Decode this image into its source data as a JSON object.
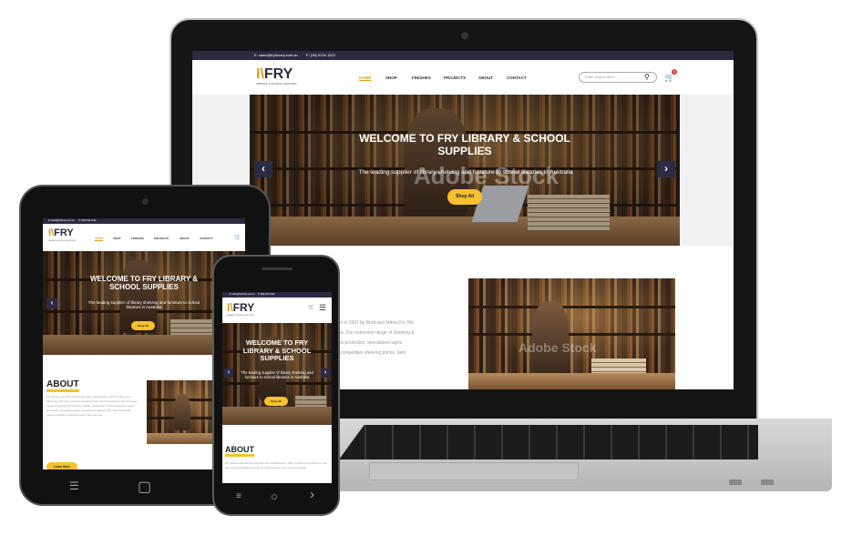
{
  "site": {
    "topbar": {
      "email": "E: sales@fryflorary.com.au",
      "phone": "P: (08) 9194 1522"
    },
    "logo": {
      "mark": "I\\",
      "name": "FRY",
      "sub": "LIBRARY & SCHOOL SUPPLIES"
    },
    "nav": [
      "HOME",
      "SHOP",
      "FINISHES",
      "PROJECTS",
      "ABOUT",
      "CONTACT"
    ],
    "search": {
      "placeholder": "Enter search here..."
    },
    "cart": {
      "count": "0"
    },
    "hero": {
      "title": "WELCOME TO FRY LIBRARY & SCHOOL SUPPLIES",
      "subtitle": "The leading supplier of library shelving and furniture to school libraries in Australia",
      "button": "Shop All",
      "watermark": "Adobe Stock",
      "prev": "‹",
      "next": "›"
    },
    "about": {
      "heading": "ABOUT",
      "text_laptop": [
        "ted in 1997 by Brett and Mitna Fry. We",
        "ess. Our extensive range of shelving &",
        "ook protection, specialised tapes",
        "e competitive shelving prices, best"
      ],
      "text_tablet": "Fry Library and School Supplies was established in 1997 by Brett and Mitna Fry. We are a proud Australian family-owned business. Our extensive range of shelving & furniture, display, equipment, office equipment, book protection, specialised tapes & cleaning supplies. We make Australia's most competitive shelving prices, best service.",
      "text_phone": "Fry Library and School Supplies was established in 1997 by Brett and Mitna Fry. We are a proud Australian family owned business. Our extensive range",
      "button": "Learn More"
    }
  },
  "tablet": {
    "home_glyph": "▢",
    "menu_glyph": "☰"
  },
  "phone": {
    "menu_glyph": "≡",
    "home_glyph": "○",
    "back_glyph": "›"
  },
  "colors": {
    "navy": "#2d2a42",
    "accent": "#f5c12e",
    "orange": "#e49b1d"
  }
}
